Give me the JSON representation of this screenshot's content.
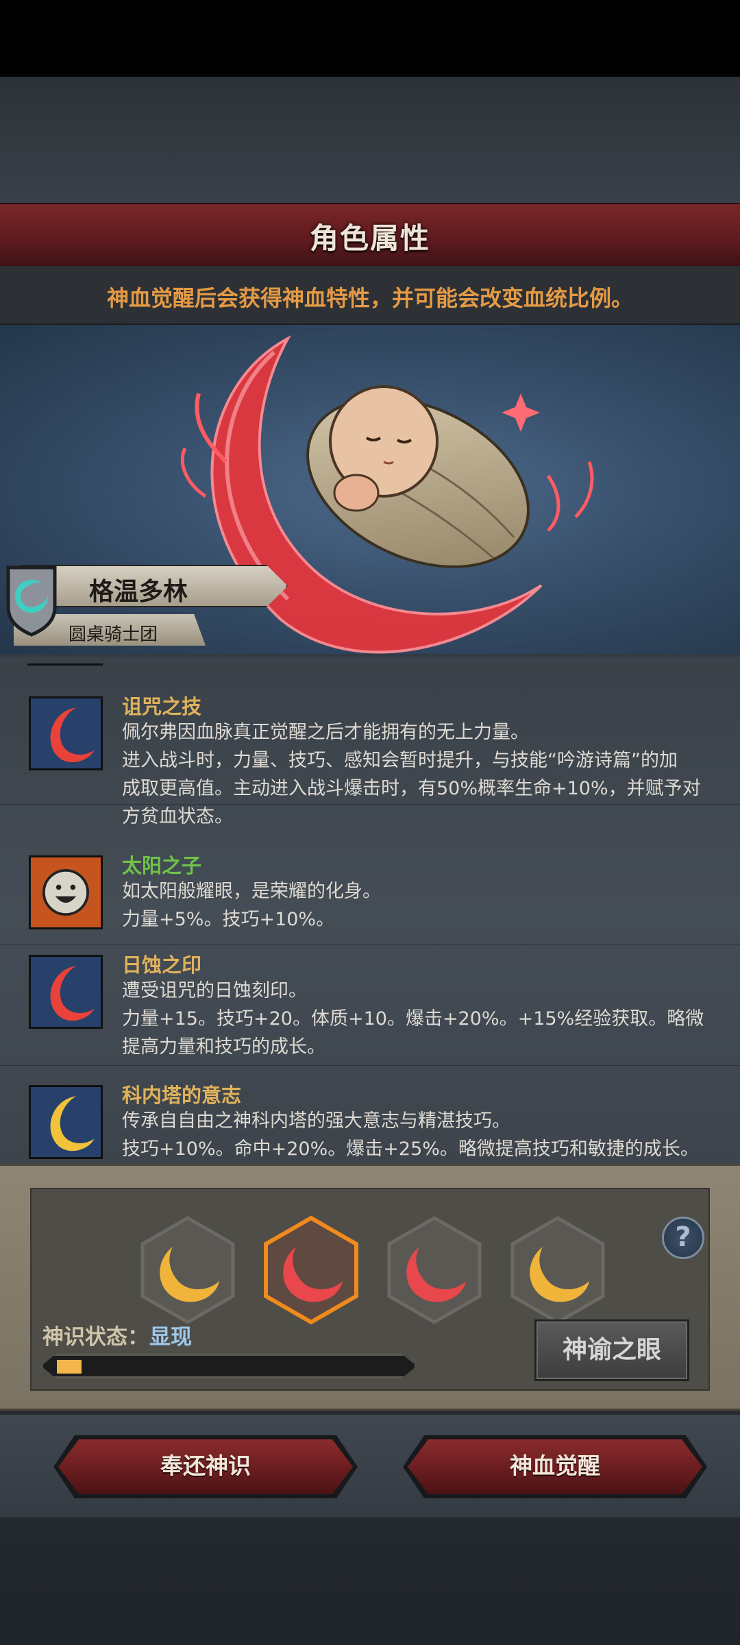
{
  "header": {
    "title": "角色属性",
    "subtitle": "神血觉醒后会获得神血特性，并可能会改变血统比例。"
  },
  "character": {
    "name": "格温多林",
    "faction": "圆桌骑士团"
  },
  "traits": [
    {
      "title": "诅咒之技",
      "title_color": "#e0b25b",
      "icon": "red-crescent-icon",
      "lines": [
        "佩尔弗因血脉真正觉醒之后才能拥有的无上力量。",
        "进入战斗时，力量、技巧、感知会暂时提升，与技能“吟游诗篇”的加",
        "成取更高值。主动进入战斗爆击时，有50%概率生命+10%，并赋予对",
        "方贫血状态。"
      ]
    },
    {
      "title": "太阳之子",
      "title_color": "#6fc24a",
      "icon": "smiling-sun-icon",
      "lines": [
        "如太阳般耀眼，是荣耀的化身。",
        "力量+5%。技巧+10%。"
      ]
    },
    {
      "title": "日蚀之印",
      "title_color": "#e0b25b",
      "icon": "red-crescent-icon",
      "lines": [
        "遭受诅咒的日蚀刻印。",
        "力量+15。技巧+20。体质+10。爆击+20%。+15%经验获取。略微",
        "提高力量和技巧的成长。"
      ]
    },
    {
      "title": "科内塔的意志",
      "title_color": "#e0b25b",
      "icon": "gold-crescent-icon",
      "lines": [
        "传承自自由之神科内塔的强大意志与精湛技巧。",
        "技巧+10%。命中+20%。爆击+25%。略微提高技巧和敏捷的成长。"
      ]
    }
  ],
  "panel": {
    "sigils": [
      {
        "name": "gold-sigil-icon",
        "color": "#f0b43a",
        "selected": false
      },
      {
        "name": "red-sigil-icon",
        "color": "#e8474b",
        "selected": true
      },
      {
        "name": "red-sigil-icon",
        "color": "#e8474b",
        "selected": false
      },
      {
        "name": "gold-sigil-icon",
        "color": "#f0b43a",
        "selected": false
      }
    ],
    "help_label": "?",
    "status_label": "神识状态：",
    "status_value": "显现",
    "progress_fraction": 0.07,
    "eye_button": "神谕之眼"
  },
  "actions": {
    "return_label": "奉还神识",
    "awaken_label": "神血觉醒"
  },
  "colors": {
    "banner": "#6a1e22",
    "accent_orange": "#e59a45",
    "selected_outline": "#f08a1c"
  }
}
